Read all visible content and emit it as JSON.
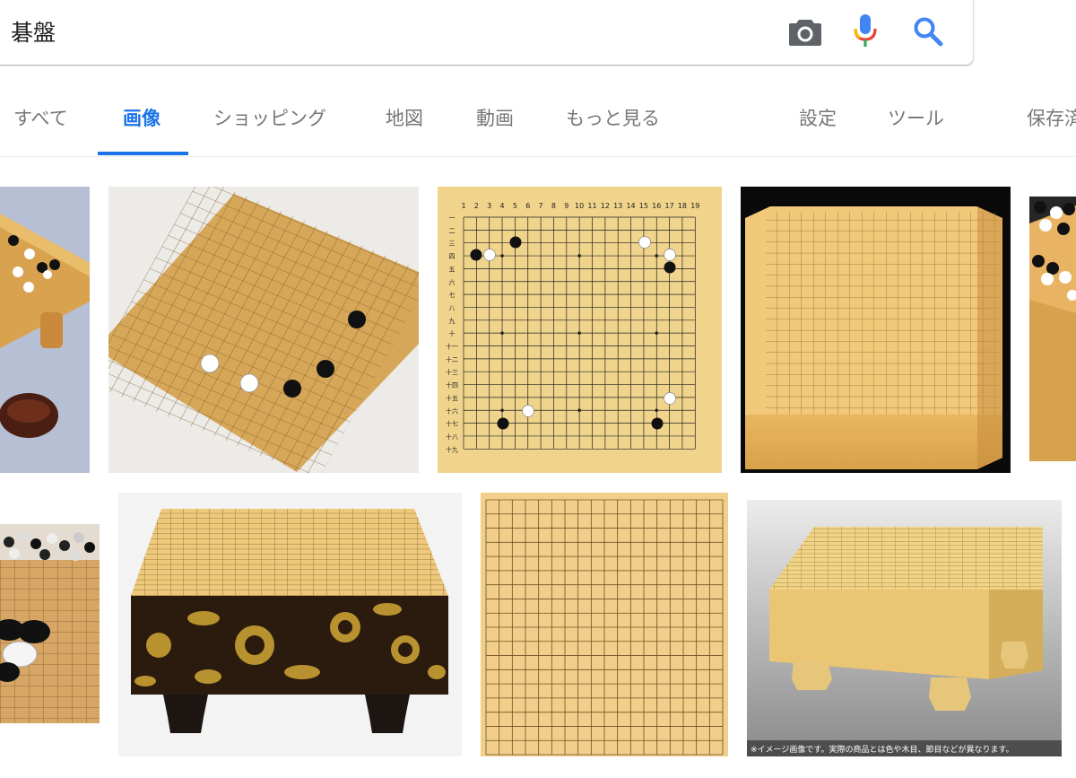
{
  "search": {
    "query": "碁盤"
  },
  "tabs": [
    {
      "label": "すべて",
      "active": false
    },
    {
      "label": "画像",
      "active": true
    },
    {
      "label": "ショッピング",
      "active": false
    },
    {
      "label": "地図",
      "active": false
    },
    {
      "label": "動画",
      "active": false
    },
    {
      "label": "もっと見る",
      "active": false
    }
  ],
  "tools": [
    {
      "label": "設定"
    },
    {
      "label": "ツール"
    },
    {
      "label": "保存済"
    }
  ],
  "results": {
    "board_numbers": [
      "1",
      "2",
      "3",
      "4",
      "5",
      "6",
      "7",
      "8",
      "9",
      "10",
      "11",
      "12",
      "13",
      "14",
      "15",
      "16",
      "17",
      "18",
      "19"
    ],
    "board_kanji": [
      "一",
      "二",
      "三",
      "四",
      "五",
      "六",
      "七",
      "八",
      "九",
      "十",
      "十一",
      "十二",
      "十三",
      "十四",
      "十五",
      "十六",
      "十七",
      "十八",
      "十九"
    ],
    "disclaimer": "※イメージ画像です。実際の商品とは色や木目、節目などが異なります。"
  },
  "colors": {
    "accent": "#1a73e8",
    "mic_blue": "#4285f4",
    "mic_red": "#ea4335",
    "mic_yellow": "#fbbc05",
    "mic_green": "#34a853",
    "wood": "#e9b866",
    "wood_light": "#f3d58e"
  }
}
